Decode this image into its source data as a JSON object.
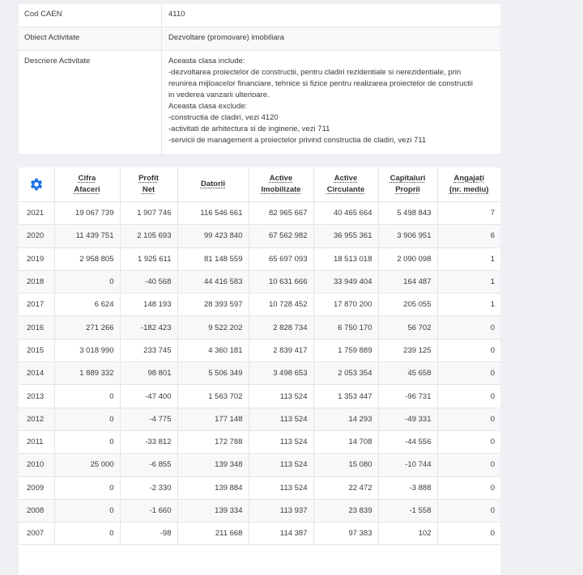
{
  "info": {
    "rows": [
      {
        "label": "Cod CAEN",
        "value": "4110"
      },
      {
        "label": "Obiect Activitate",
        "value": "Dezvoltare (promovare) imobiliara"
      },
      {
        "label": "Descriere Activitate",
        "lines": [
          "Aceasta clasa include:",
          "-dezvoltarea proiectelor de constructii, pentru cladiri rezidentiale si nerezidentiale, prin",
          "reunirea mijloacelor financiare, tehnice si fizice pentru realizarea proiectelor de constructii",
          "in vederea vanzarii ulterioare.",
          "Aceasta clasa exclude:",
          "-constructia de cladiri, vezi 4120",
          "-activitati de arhitectura si de inginerie, vezi 711",
          "-servicii de management a proiectelor privind constructia de cladiri, vezi 711"
        ]
      }
    ]
  },
  "financial": {
    "settings_icon": "gear-icon",
    "accent": "#1a73e8",
    "headers": [
      [
        "Cifra",
        "Afaceri"
      ],
      [
        "Profit",
        "Net"
      ],
      [
        "Datorii"
      ],
      [
        "Active",
        "Imobilizate"
      ],
      [
        "Active",
        "Circulante"
      ],
      [
        "Capitaluri",
        "Proprii"
      ],
      [
        "Angajați",
        "(nr. mediu)"
      ]
    ],
    "rows": [
      [
        "2021",
        "19 067 739",
        "1 907 746",
        "116 546 661",
        "82 965 667",
        "40 465 664",
        "5 498 843",
        "7"
      ],
      [
        "2020",
        "11 439 751",
        "2 105 693",
        "99 423 840",
        "67 562 982",
        "36 955 361",
        "3 906 951",
        "6"
      ],
      [
        "2019",
        "2 958 805",
        "1 925 611",
        "81 148 559",
        "65 697 093",
        "18 513 018",
        "2 090 098",
        "1"
      ],
      [
        "2018",
        "0",
        "-40 568",
        "44 416 583",
        "10 631 666",
        "33 949 404",
        "164 487",
        "1"
      ],
      [
        "2017",
        "6 624",
        "148 193",
        "28 393 597",
        "10 728 452",
        "17 870 200",
        "205 055",
        "1"
      ],
      [
        "2016",
        "271 266",
        "-182 423",
        "9 522 202",
        "2 828 734",
        "6 750 170",
        "56 702",
        "0"
      ],
      [
        "2015",
        "3 018 990",
        "233 745",
        "4 360 181",
        "2 839 417",
        "1 759 889",
        "239 125",
        "0"
      ],
      [
        "2014",
        "1 889 332",
        "98 801",
        "5 506 349",
        "3 498 653",
        "2 053 354",
        "45 658",
        "0"
      ],
      [
        "2013",
        "0",
        "-47 400",
        "1 563 702",
        "113 524",
        "1 353 447",
        "-96 731",
        "0"
      ],
      [
        "2012",
        "0",
        "-4 775",
        "177 148",
        "113 524",
        "14 293",
        "-49 331",
        "0"
      ],
      [
        "2011",
        "0",
        "-33 812",
        "172 788",
        "113 524",
        "14 708",
        "-44 556",
        "0"
      ],
      [
        "2010",
        "25 000",
        "-6 855",
        "139 348",
        "113 524",
        "15 080",
        "-10 744",
        "0"
      ],
      [
        "2009",
        "0",
        "-2 330",
        "139 884",
        "113 524",
        "22 472",
        "-3 888",
        "0"
      ],
      [
        "2008",
        "0",
        "-1 660",
        "139 334",
        "113 937",
        "23 839",
        "-1 558",
        "0"
      ],
      [
        "2007",
        "0",
        "-98",
        "211 668",
        "114 387",
        "97 383",
        "102",
        "0"
      ]
    ]
  }
}
